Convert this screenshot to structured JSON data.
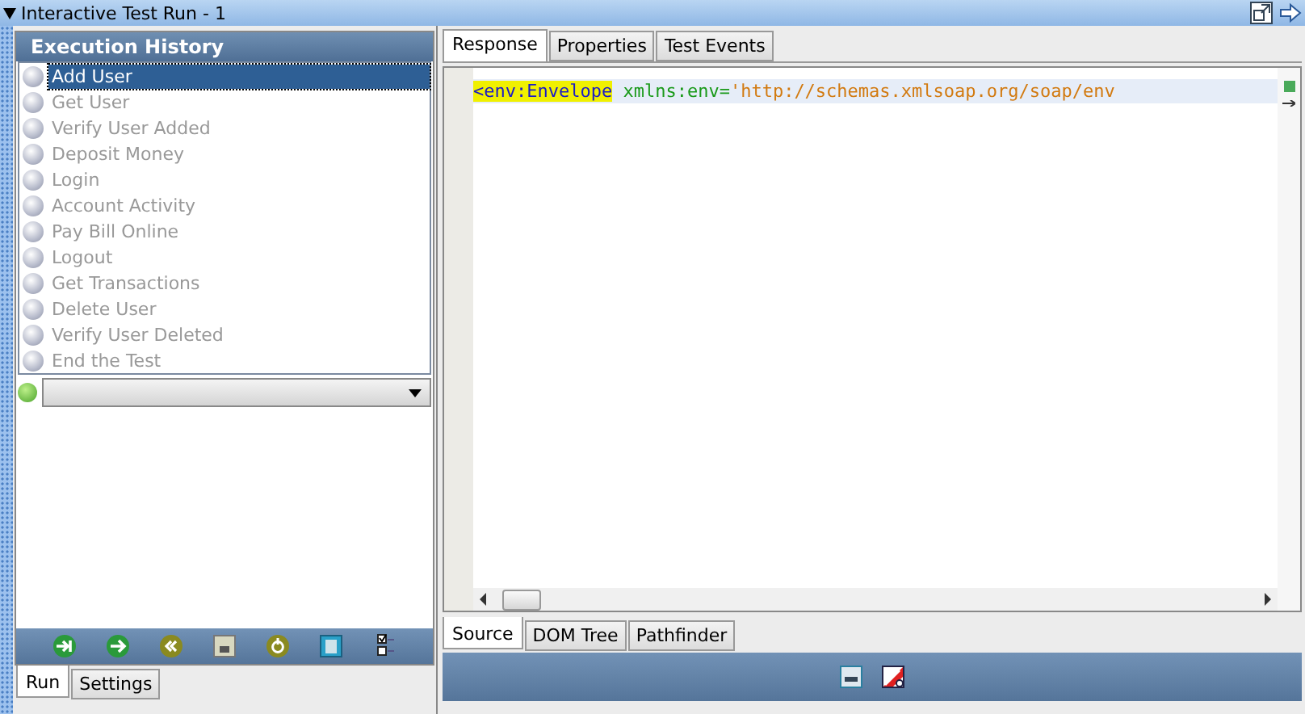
{
  "window": {
    "title": "Interactive Test Run - 1"
  },
  "execution_history": {
    "title": "Execution History",
    "items": [
      {
        "label": "Add User",
        "selected": true
      },
      {
        "label": "Get User",
        "selected": false
      },
      {
        "label": "Verify User Added",
        "selected": false
      },
      {
        "label": "Deposit Money",
        "selected": false
      },
      {
        "label": "Login",
        "selected": false
      },
      {
        "label": "Account Activity",
        "selected": false
      },
      {
        "label": "Pay Bill Online",
        "selected": false
      },
      {
        "label": "Logout",
        "selected": false
      },
      {
        "label": "Get Transactions",
        "selected": false
      },
      {
        "label": "Delete User",
        "selected": false
      },
      {
        "label": "Verify User Deleted",
        "selected": false
      },
      {
        "label": "End the Test",
        "selected": false
      }
    ]
  },
  "left_tabs": [
    {
      "label": "Run",
      "selected": true
    },
    {
      "label": "Settings",
      "selected": false
    }
  ],
  "response_tabs": [
    {
      "label": "Response",
      "selected": true
    },
    {
      "label": "Properties",
      "selected": false
    },
    {
      "label": "Test Events",
      "selected": false
    }
  ],
  "editor": {
    "tokens": [
      {
        "kind": "tag",
        "text": "<env:Envelope"
      },
      {
        "kind": "attr",
        "text": " xmlns:env="
      },
      {
        "kind": "value",
        "text": "'http://schemas.xmlsoap.org/soap/env"
      }
    ]
  },
  "view_tabs": [
    {
      "label": "Source",
      "selected": true
    },
    {
      "label": "DOM Tree",
      "selected": false
    },
    {
      "label": "Pathfinder",
      "selected": false
    }
  ]
}
